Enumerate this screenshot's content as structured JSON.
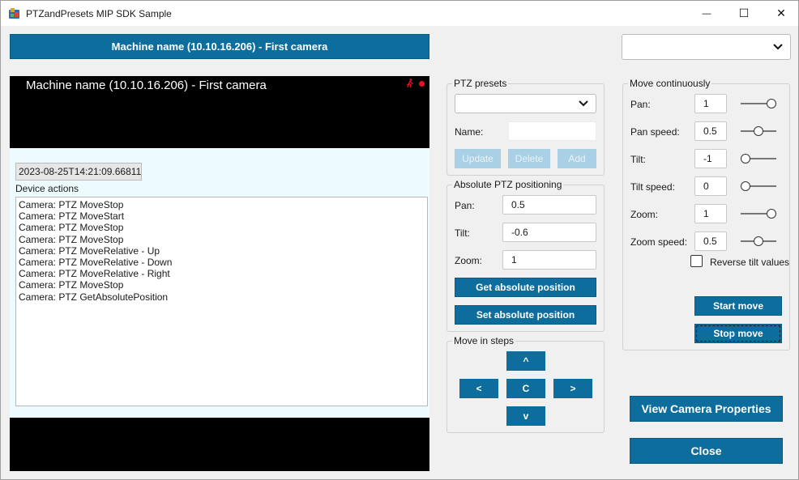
{
  "window": {
    "title": "PTZandPresets MIP SDK Sample",
    "minimize_glyph": "—",
    "maximize_glyph": "☐",
    "close_glyph": "✕"
  },
  "camera_button": {
    "label": "Machine name (10.10.16.206) - First camera"
  },
  "top_combo": {
    "value": ""
  },
  "video": {
    "title": "Machine name (10.10.16.206) - First camera",
    "timestamp": "2023-08-25T14:21:09.66811.",
    "device_actions_label": "Device actions",
    "device_actions": [
      "Camera: PTZ MoveStop",
      "Camera: PTZ MoveStart",
      "Camera: PTZ MoveStop",
      "Camera: PTZ MoveStop",
      "Camera: PTZ MoveRelative - Up",
      "Camera: PTZ MoveRelative - Down",
      "Camera: PTZ MoveRelative - Right",
      "Camera: PTZ MoveStop",
      "Camera: PTZ GetAbsolutePosition"
    ]
  },
  "presets": {
    "title": "PTZ presets",
    "combo_value": "",
    "name_label": "Name:",
    "name_value": "",
    "update_label": "Update",
    "delete_label": "Delete",
    "add_label": "Add"
  },
  "absolute": {
    "title": "Absolute PTZ positioning",
    "pan_label": "Pan:",
    "pan_value": "0.5",
    "tilt_label": "Tilt:",
    "tilt_value": "-0.6",
    "zoom_label": "Zoom:",
    "zoom_value": "1",
    "get_label": "Get absolute position",
    "set_label": "Set absolute position"
  },
  "steps": {
    "title": "Move in steps",
    "up": "^",
    "left": "<",
    "center": "C",
    "right": ">",
    "down": "v"
  },
  "continuous": {
    "title": "Move continuously",
    "rows": [
      {
        "label": "Pan:",
        "value": "1",
        "slider_level": 1.0
      },
      {
        "label": "Pan speed:",
        "value": "0.5",
        "slider_level": 0.5
      },
      {
        "label": "Tilt:",
        "value": "-1",
        "slider_level": 0.0
      },
      {
        "label": "Tilt speed:",
        "value": "0",
        "slider_level": 0.0
      },
      {
        "label": "Zoom:",
        "value": "1",
        "slider_level": 1.0
      },
      {
        "label": "Zoom speed:",
        "value": "0.5",
        "slider_level": 0.5
      }
    ],
    "reverse_label": "Reverse tilt values",
    "reverse_checked": false,
    "start_label": "Start move",
    "stop_label": "Stop move"
  },
  "view_props_label": "View Camera Properties",
  "close_label": "Close",
  "colors": {
    "accent": "#0d6e9e",
    "disabled": "#a9d0e4",
    "rec": "#e81123"
  }
}
